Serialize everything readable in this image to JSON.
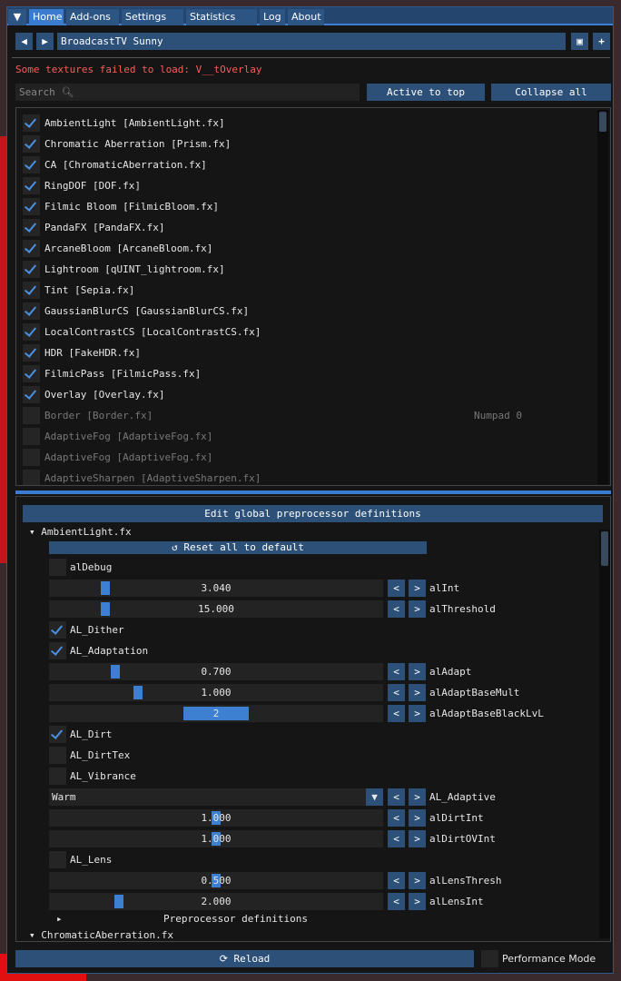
{
  "tabs": [
    "Home",
    "Add-ons",
    "Settings",
    "Statistics",
    "Log",
    "About"
  ],
  "active_tab": "Home",
  "preset": {
    "name": "BroadcastTV Sunny",
    "prev": "◀",
    "next": "▶",
    "save_icon": "save-icon",
    "add": "+"
  },
  "error": "Some textures failed to load: V__tOverlay",
  "search": {
    "placeholder": "Search",
    "icon": "search-icon"
  },
  "buttons": {
    "active_to_top": "Active to top",
    "collapse_all": "Collapse all",
    "edit_global": "Edit global preprocessor definitions",
    "reset_all": "Reset all to default",
    "reload": "Reload",
    "performance_mode": "Performance Mode"
  },
  "effects": [
    {
      "label": "AmbientLight [AmbientLight.fx]",
      "enabled": true
    },
    {
      "label": "Chromatic Aberration [Prism.fx]",
      "enabled": true
    },
    {
      "label": "CA [ChromaticAberration.fx]",
      "enabled": true
    },
    {
      "label": "RingDOF [DOF.fx]",
      "enabled": true
    },
    {
      "label": "Filmic Bloom [FilmicBloom.fx]",
      "enabled": true
    },
    {
      "label": "PandaFX [PandaFX.fx]",
      "enabled": true
    },
    {
      "label": "ArcaneBloom [ArcaneBloom.fx]",
      "enabled": true
    },
    {
      "label": "Lightroom [qUINT_lightroom.fx]",
      "enabled": true
    },
    {
      "label": "Tint [Sepia.fx]",
      "enabled": true
    },
    {
      "label": "GaussianBlurCS [GaussianBlurCS.fx]",
      "enabled": true
    },
    {
      "label": "LocalContrastCS [LocalContrastCS.fx]",
      "enabled": true
    },
    {
      "label": "HDR [FakeHDR.fx]",
      "enabled": true
    },
    {
      "label": "FilmicPass [FilmicPass.fx]",
      "enabled": true
    },
    {
      "label": "Overlay [Overlay.fx]",
      "enabled": true
    },
    {
      "label": "Border [Border.fx]",
      "enabled": false,
      "shortcut": "Numpad 0"
    },
    {
      "label": "AdaptiveFog [AdaptiveFog.fx]",
      "enabled": false
    },
    {
      "label": "AdaptiveFog [AdaptiveFog.fx]",
      "enabled": false
    },
    {
      "label": "AdaptiveSharpen [AdaptiveSharpen.fx]",
      "enabled": false
    }
  ],
  "section": {
    "title": "AmbientLight.fx",
    "next_title": "ChromaticAberration.fx",
    "preprocessor": "Preprocessor definitions"
  },
  "params": [
    {
      "type": "check",
      "name": "alDebug",
      "checked": false
    },
    {
      "type": "slider",
      "name": "alInt",
      "value": "3.040",
      "level": 0.16
    },
    {
      "type": "slider",
      "name": "alThreshold",
      "value": "15.000",
      "level": 0.16
    },
    {
      "type": "check",
      "name": "AL_Dither",
      "checked": true
    },
    {
      "type": "check",
      "name": "AL_Adaptation",
      "checked": true
    },
    {
      "type": "slider",
      "name": "alAdapt",
      "value": "0.700",
      "level": 0.19
    },
    {
      "type": "slider",
      "name": "alAdaptBaseMult",
      "value": "1.000",
      "level": 0.26
    },
    {
      "type": "slider",
      "name": "alAdaptBaseBlackLvL",
      "value": "2",
      "level": 0.5,
      "wide": true
    },
    {
      "type": "check",
      "name": "AL_Dirt",
      "checked": true
    },
    {
      "type": "check",
      "name": "AL_DirtTex",
      "checked": false
    },
    {
      "type": "check",
      "name": "AL_Vibrance",
      "checked": false
    },
    {
      "type": "combo",
      "name": "AL_Adaptive",
      "value": "Warm"
    },
    {
      "type": "slider",
      "name": "alDirtInt",
      "value": "1.000",
      "level": 0.5
    },
    {
      "type": "slider",
      "name": "alDirtOVInt",
      "value": "1.000",
      "level": 0.5
    },
    {
      "type": "check",
      "name": "AL_Lens",
      "checked": false
    },
    {
      "type": "slider",
      "name": "alLensThresh",
      "value": "0.500",
      "level": 0.5
    },
    {
      "type": "slider",
      "name": "alLensInt",
      "value": "2.000",
      "level": 0.2
    }
  ],
  "colors": {
    "accent": "#3d7fd0",
    "button": "#2c5078",
    "error": "#ff5a5a"
  }
}
